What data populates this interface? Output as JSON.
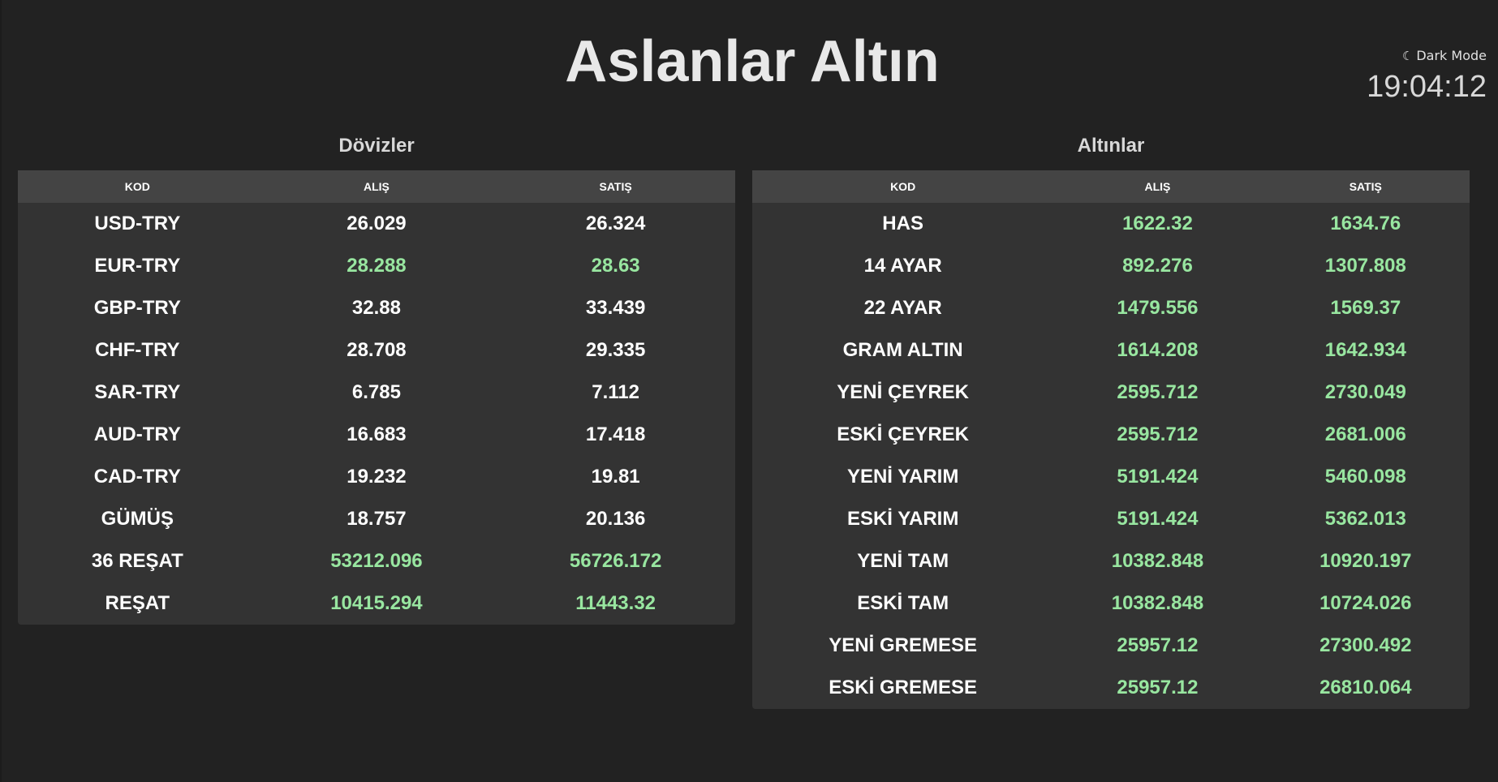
{
  "header": {
    "title": "Aslanlar Altın",
    "dark_mode_icon": "moon-icon",
    "dark_mode_label": "Dark Mode",
    "clock": "19:04:12"
  },
  "colors": {
    "background": "#222222",
    "table_body": "#333333",
    "table_head": "#444444",
    "up_green": "#98e6a0"
  },
  "doviz": {
    "title": "Dövizler",
    "columns": [
      "KOD",
      "ALIŞ",
      "SATIŞ"
    ],
    "rows": [
      {
        "kod": "USD-TRY",
        "alis": "26.029",
        "satis": "26.324",
        "up": false
      },
      {
        "kod": "EUR-TRY",
        "alis": "28.288",
        "satis": "28.63",
        "up": true
      },
      {
        "kod": "GBP-TRY",
        "alis": "32.88",
        "satis": "33.439",
        "up": false
      },
      {
        "kod": "CHF-TRY",
        "alis": "28.708",
        "satis": "29.335",
        "up": false
      },
      {
        "kod": "SAR-TRY",
        "alis": "6.785",
        "satis": "7.112",
        "up": false
      },
      {
        "kod": "AUD-TRY",
        "alis": "16.683",
        "satis": "17.418",
        "up": false
      },
      {
        "kod": "CAD-TRY",
        "alis": "19.232",
        "satis": "19.81",
        "up": false
      },
      {
        "kod": "GÜMÜŞ",
        "alis": "18.757",
        "satis": "20.136",
        "up": false
      },
      {
        "kod": "36 REŞAT",
        "alis": "53212.096",
        "satis": "56726.172",
        "up": true
      },
      {
        "kod": "REŞAT",
        "alis": "10415.294",
        "satis": "11443.32",
        "up": true
      }
    ]
  },
  "altin": {
    "title": "Altınlar",
    "columns": [
      "KOD",
      "ALIŞ",
      "SATIŞ"
    ],
    "rows": [
      {
        "kod": "HAS",
        "alis": "1622.32",
        "satis": "1634.76",
        "up": true
      },
      {
        "kod": "14 AYAR",
        "alis": "892.276",
        "satis": "1307.808",
        "up": true
      },
      {
        "kod": "22 AYAR",
        "alis": "1479.556",
        "satis": "1569.37",
        "up": true
      },
      {
        "kod": "GRAM ALTIN",
        "alis": "1614.208",
        "satis": "1642.934",
        "up": true
      },
      {
        "kod": "YENİ ÇEYREK",
        "alis": "2595.712",
        "satis": "2730.049",
        "up": true
      },
      {
        "kod": "ESKİ ÇEYREK",
        "alis": "2595.712",
        "satis": "2681.006",
        "up": true
      },
      {
        "kod": "YENİ YARIM",
        "alis": "5191.424",
        "satis": "5460.098",
        "up": true
      },
      {
        "kod": "ESKİ YARIM",
        "alis": "5191.424",
        "satis": "5362.013",
        "up": true
      },
      {
        "kod": "YENİ TAM",
        "alis": "10382.848",
        "satis": "10920.197",
        "up": true
      },
      {
        "kod": "ESKİ TAM",
        "alis": "10382.848",
        "satis": "10724.026",
        "up": true
      },
      {
        "kod": "YENİ GREMESE",
        "alis": "25957.12",
        "satis": "27300.492",
        "up": true
      },
      {
        "kod": "ESKİ GREMESE",
        "alis": "25957.12",
        "satis": "26810.064",
        "up": true
      }
    ]
  }
}
